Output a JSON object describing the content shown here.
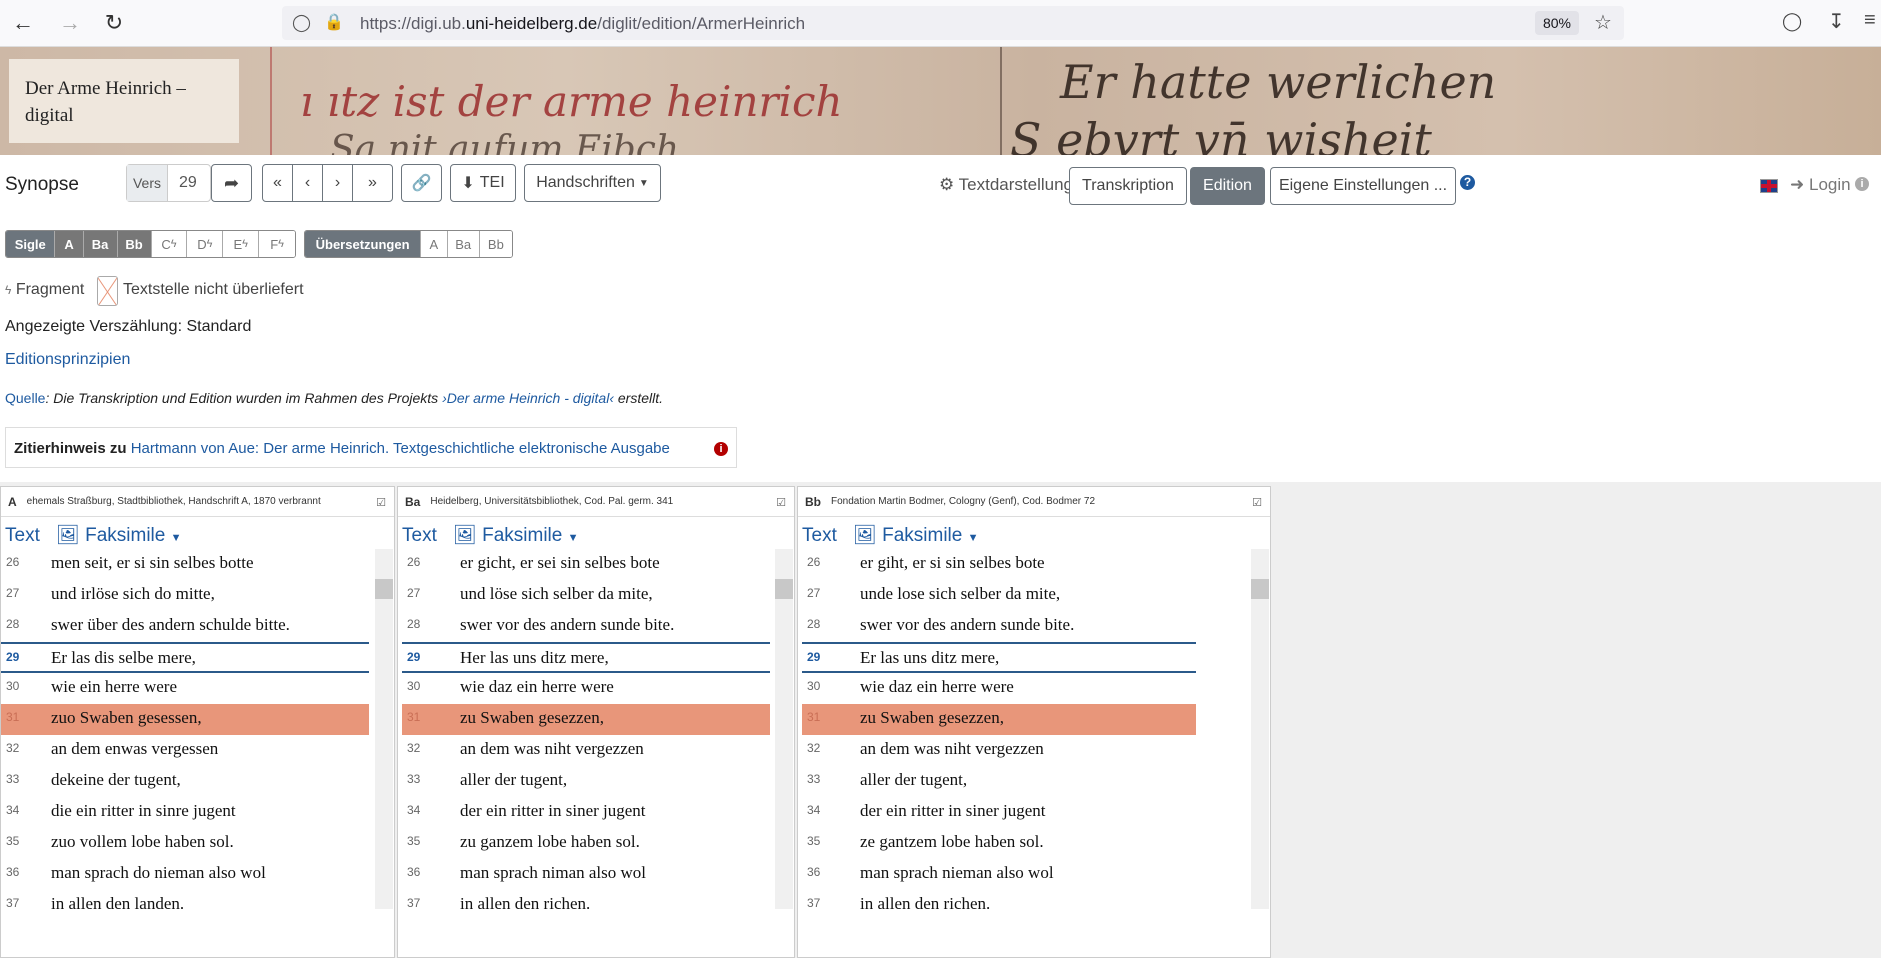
{
  "browser": {
    "url_prefix": "https://digi.ub.",
    "url_host": "uni-heidelberg.de",
    "url_path": "/diglit/edition/ArmerHeinrich",
    "zoom": "80%"
  },
  "banner": {
    "title_line1": "Der Arme Heinrich –",
    "title_line2": "digital"
  },
  "toolbar": {
    "synopse": "Synopse",
    "vers_label": "Vers",
    "vers_value": "29",
    "tei": "TEI",
    "handschriften": "Handschriften",
    "textdarstellung": "Textdarstellung",
    "transkription": "Transkription",
    "edition": "Edition",
    "eigene": "Eigene Einstellungen ...",
    "login": "Login"
  },
  "sigle": {
    "label": "Sigle",
    "items": [
      "A",
      "Ba",
      "Bb",
      "C",
      "D",
      "E",
      "F"
    ],
    "uebersetzungen": "Übersetzungen",
    "trans_items": [
      "A",
      "Ba",
      "Bb"
    ]
  },
  "legend": {
    "fragment": "Fragment",
    "missing": "Textstelle nicht überliefert"
  },
  "info": {
    "verszaehlung": "Angezeigte Verszählung: Standard",
    "editionsprinzipien": "Editionsprinzipien",
    "quelle_label": "Quelle",
    "quelle_text": ": Die Transkription und Edition wurden im Rahmen des Projekts ",
    "quelle_link": "›Der arme Heinrich - digital‹",
    "quelle_end": " erstellt.",
    "zitier_label": "Zitierhinweis zu",
    "zitier_link": "Hartmann von Aue: Der arme Heinrich. Textgeschichtliche elektronische Ausgabe"
  },
  "panels": [
    {
      "sigle": "A",
      "desc": "ehemals Straßburg, Stadtbibliothek, Handschrift A, 1870 verbrannt",
      "text_tab": "Text",
      "faksimile": "Faksimile",
      "verses": [
        [
          "26",
          "men seit, er si sin selbes botte"
        ],
        [
          "27",
          "und irlöse sich do mitte,"
        ],
        [
          "28",
          "swer über des andern schulde bitte."
        ],
        [
          "29",
          "Er las dis selbe mere,"
        ],
        [
          "30",
          "wie ein herre were"
        ],
        [
          "31",
          "zuo Swaben gesessen,"
        ],
        [
          "32",
          "an dem enwas vergessen"
        ],
        [
          "33",
          "dekeine der tugent,"
        ],
        [
          "34",
          "die ein ritter in sinre jugent"
        ],
        [
          "35",
          "zuo vollem lobe haben sol."
        ],
        [
          "36",
          "man sprach do nieman also wol"
        ],
        [
          "37",
          "in allen den landen."
        ]
      ]
    },
    {
      "sigle": "Ba",
      "desc": "Heidelberg, Universitätsbibliothek, Cod. Pal. germ. 341",
      "text_tab": "Text",
      "faksimile": "Faksimile",
      "verses": [
        [
          "26",
          "er gicht, er sei sin selbes bote"
        ],
        [
          "27",
          "und löse sich selber da mite,"
        ],
        [
          "28",
          "swer vor des andern sunde bite."
        ],
        [
          "29",
          "Her las uns ditz mere,"
        ],
        [
          "30",
          "wie daz ein herre were"
        ],
        [
          "31",
          "zu Swaben gesezzen,"
        ],
        [
          "32",
          "an dem was niht vergezzen"
        ],
        [
          "33",
          "aller der tugent,"
        ],
        [
          "34",
          "der ein ritter in siner jugent"
        ],
        [
          "35",
          "zu ganzem lobe haben sol."
        ],
        [
          "36",
          "man sprach niman also wol"
        ],
        [
          "37",
          "in allen den richen."
        ]
      ]
    },
    {
      "sigle": "Bb",
      "desc": "Fondation Martin Bodmer, Cologny (Genf), Cod. Bodmer 72",
      "text_tab": "Text",
      "faksimile": "Faksimile",
      "verses": [
        [
          "26",
          "er giht, er si sin selbes bote"
        ],
        [
          "27",
          "unde lose sich selber da mite,"
        ],
        [
          "28",
          "swer vor des andern sunde bite."
        ],
        [
          "29",
          "Er las uns ditz mere,"
        ],
        [
          "30",
          "wie daz ein herre were"
        ],
        [
          "31",
          "zu Swaben gesezzen,"
        ],
        [
          "32",
          "an dem was niht vergezzen"
        ],
        [
          "33",
          "aller der tugent,"
        ],
        [
          "34",
          "der ein ritter in siner jugent"
        ],
        [
          "35",
          "ze gantzem lobe haben sol."
        ],
        [
          "36",
          "man sprach nieman also wol"
        ],
        [
          "37",
          "in allen den richen."
        ]
      ]
    }
  ]
}
